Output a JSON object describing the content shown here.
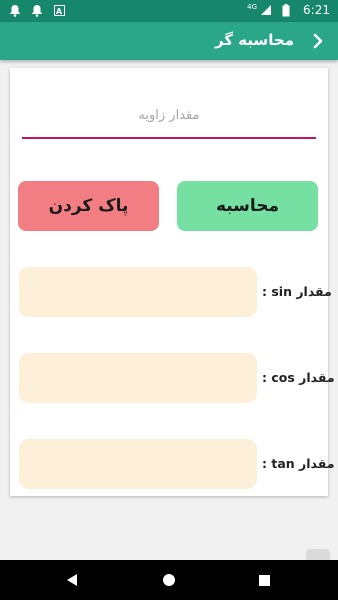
{
  "status_bar": {
    "network": "4G",
    "time": "6:21",
    "icons": [
      "notification-bell-icon",
      "notification-bell-icon",
      "app-notification-icon",
      "network-signal-icon",
      "battery-icon"
    ]
  },
  "app_bar": {
    "title": "محاسبه گر",
    "back_icon": "chevron-right-icon"
  },
  "form": {
    "angle_placeholder": "مقدار زاویه",
    "angle_value": ""
  },
  "buttons": {
    "calculate": "محاسبه",
    "clear": "پاک کردن"
  },
  "results": {
    "sin_label": "مقدار sin :",
    "cos_label": "مقدار cos :",
    "tan_label": "مقدار tan :",
    "sin_value": "",
    "cos_value": "",
    "tan_value": ""
  },
  "colors": {
    "status_bar": "#16876b",
    "app_bar": "#2aa689",
    "input_underline": "#c2185b",
    "calculate_button": "#75e0a2",
    "clear_button": "#f27e84",
    "result_box": "#feefd8"
  },
  "nav_bar": {
    "icons": [
      "back-triangle-icon",
      "home-circle-icon",
      "recents-square-icon"
    ]
  }
}
